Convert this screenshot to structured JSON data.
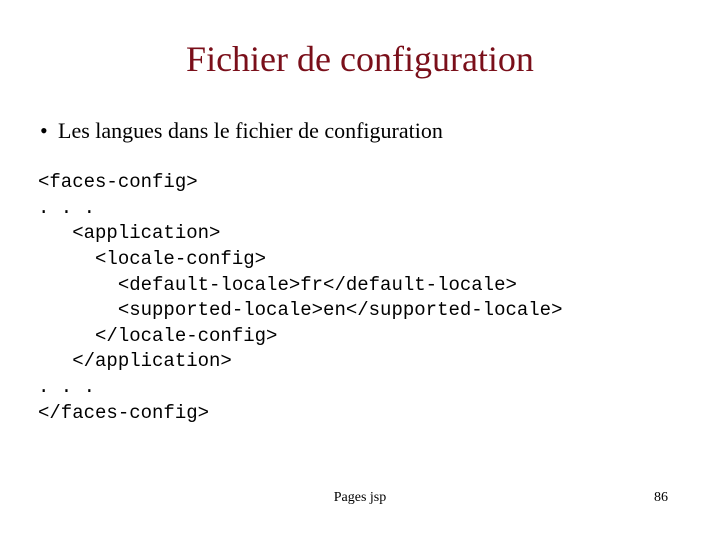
{
  "title": "Fichier de configuration",
  "bullet": "Les langues dans le fichier de configuration",
  "code": {
    "l0": "<faces-config>",
    "l1": ". . .",
    "l2": "   <application>",
    "l3": "     <locale-config>",
    "l4": "       <default-locale>fr</default-locale>",
    "l5": "       <supported-locale>en</supported-locale>",
    "l6": "     </locale-config>",
    "l7": "   </application>",
    "l8": ". . .",
    "l9": "</faces-config>"
  },
  "footer": {
    "center": "Pages jsp",
    "page": "86"
  }
}
